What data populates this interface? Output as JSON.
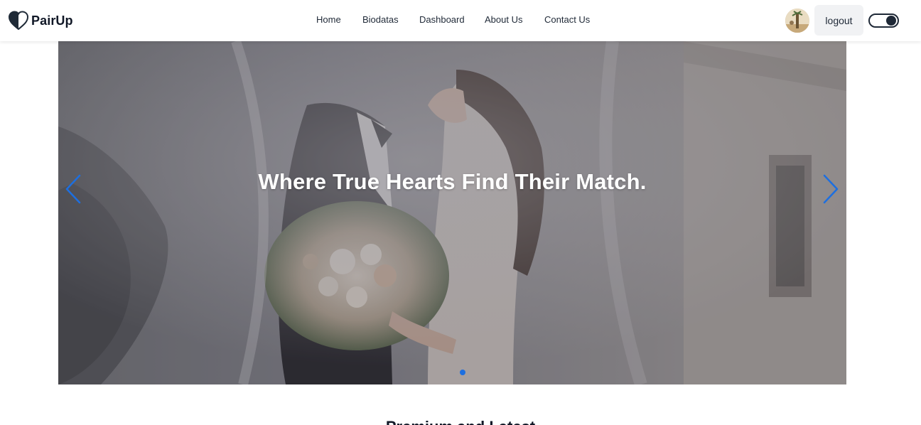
{
  "brand": {
    "name": "PairUp",
    "logo_icon": "heart-icon"
  },
  "nav": {
    "items": [
      {
        "label": "Home"
      },
      {
        "label": "Biodatas"
      },
      {
        "label": "Dashboard"
      },
      {
        "label": "About Us"
      },
      {
        "label": "Contact Us"
      }
    ]
  },
  "user": {
    "avatar_icon": "avatar",
    "logout_label": "logout"
  },
  "theme_toggle": {
    "state": "dark",
    "icon": "toggle-switch"
  },
  "hero": {
    "title": "Where True Hearts Find Their Match.",
    "prev_icon": "chevron-left-icon",
    "next_icon": "chevron-right-icon",
    "slide_count": 1,
    "active_slide": 1,
    "arrow_color": "#1d6fe0"
  },
  "next_section": {
    "heading": "Premium and Latest"
  }
}
